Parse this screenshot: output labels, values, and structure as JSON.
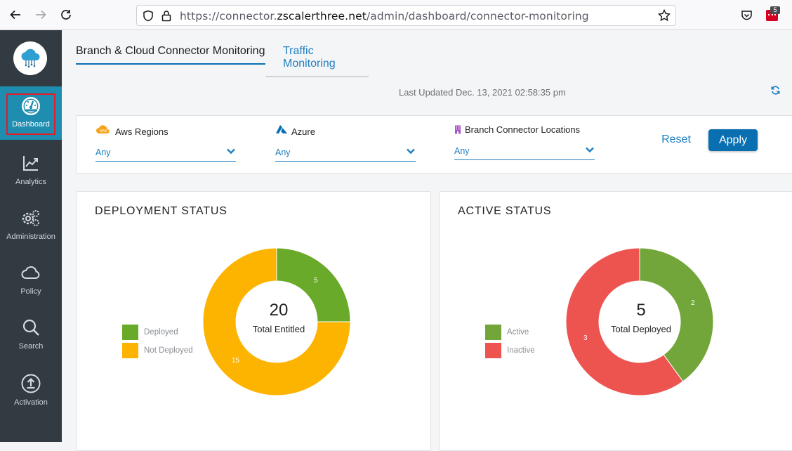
{
  "browser": {
    "url_prefix": "https://connector.",
    "url_domain": "zscalerthree.net",
    "url_path": "/admin/dashboard/connector-monitoring",
    "extension_badge": "5"
  },
  "sidebar": {
    "items": [
      {
        "label": "Dashboard",
        "icon": "gauge-icon"
      },
      {
        "label": "Analytics",
        "icon": "chart-line-icon"
      },
      {
        "label": "Administration",
        "icon": "gears-icon"
      },
      {
        "label": "Policy",
        "icon": "cloud-icon"
      },
      {
        "label": "Search",
        "icon": "search-icon"
      },
      {
        "label": "Activation",
        "icon": "upload-icon"
      }
    ]
  },
  "tabs": [
    {
      "label": "Branch & Cloud Connector Monitoring",
      "active": true
    },
    {
      "label": "Traffic Monitoring",
      "active": false
    }
  ],
  "last_updated": "Last Updated Dec. 13, 2021 02:58:35 pm",
  "filters": {
    "aws": {
      "title": "Aws Regions",
      "value": "Any",
      "icon": "aws-icon"
    },
    "azure": {
      "title": "Azure",
      "value": "Any",
      "icon": "azure-icon"
    },
    "branch": {
      "title": "Branch Connector Locations",
      "value": "Any",
      "icon": "building-icon"
    },
    "reset_label": "Reset",
    "apply_label": "Apply"
  },
  "colors": {
    "accent": "#0a6fb1",
    "green": "#6aaa2a",
    "amber": "#fdb400",
    "red": "#ed5450",
    "sidebar": "#323a42"
  },
  "deployment": {
    "title": "DEPLOYMENT STATUS",
    "center_value": "20",
    "center_label": "Total Entitled",
    "legend": [
      "Deployed",
      "Not Deployed"
    ],
    "chart_data": {
      "type": "pie",
      "categories": [
        "Deployed",
        "Not Deployed"
      ],
      "values": [
        5,
        15
      ],
      "colors": [
        "#6aaa2a",
        "#fdb400"
      ]
    }
  },
  "active": {
    "title": "ACTIVE STATUS",
    "center_value": "5",
    "center_label": "Total Deployed",
    "legend": [
      "Active",
      "Inactive"
    ],
    "chart_data": {
      "type": "pie",
      "categories": [
        "Active",
        "Inactive"
      ],
      "values": [
        2,
        3
      ],
      "colors": [
        "#72a63a",
        "#ed5450"
      ]
    }
  }
}
